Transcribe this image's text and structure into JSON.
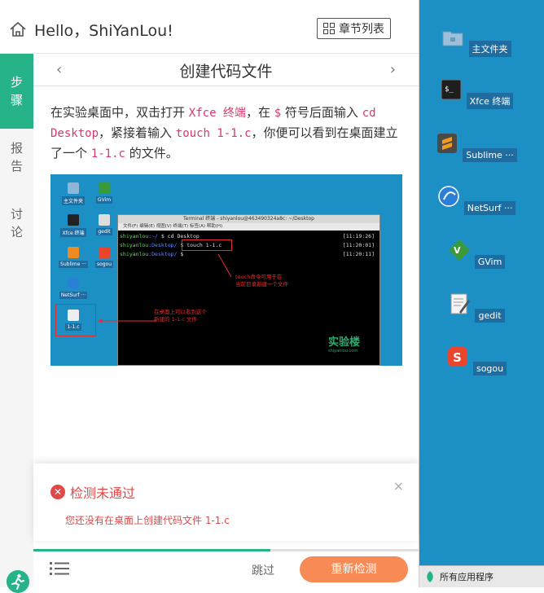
{
  "topbar": {
    "app_title": "Hello，ShiYanLou!",
    "chapter_button": "章节列表"
  },
  "side_tabs": [
    {
      "label_line1": "步",
      "label_line2": "骤"
    },
    {
      "label_line1": "报",
      "label_line2": "告"
    },
    {
      "label_line1": "讨",
      "label_line2": "论"
    }
  ],
  "step": {
    "title": "创建代码文件",
    "prev": "‹",
    "next": "›",
    "instruction": {
      "t1": "在实验桌面中，双击打开 ",
      "c1": "Xfce 终端",
      "t2": "，在 ",
      "c2": "$",
      "t3": " 符号后面输入 ",
      "c3": "cd Desktop",
      "t4": "，紧接着输入 ",
      "c4": "touch 1-1.c",
      "t5": "，你便可以看到在桌面建立了一个 ",
      "c5": "1-1.c",
      "t6": " 的文件。"
    }
  },
  "screenshot": {
    "icons": [
      "主文件夹",
      "GVim",
      "Xfce 终端",
      "gedit",
      "Sublime ···",
      "sogou",
      "NetSurf ···",
      "1-1.c"
    ],
    "terminal_title": "Terminal 终端 - shiyanlou@463490324a8c: ~/Desktop",
    "terminal_menu": "文件(F)   编辑(E)   视图(V)   终端(T)   标签(A)   帮助(H)",
    "lines": [
      {
        "user": "shiyanlou",
        "dir": ":~/ ",
        "cmd": "$ cd Desktop",
        "time": "[11:19:26]"
      },
      {
        "user": "shiyanlou",
        "dir": ":Desktop/ ",
        "cmd": "$ touch 1-1.c",
        "time": "[11:20:01]"
      },
      {
        "user": "shiyanlou",
        "dir": ":Desktop/ ",
        "cmd": "$ ",
        "time": "[11:20:11]"
      }
    ],
    "annotation1_line1": "touch命令可用于在",
    "annotation1_line2": "当前目录新建一个文件",
    "annotation2_line1": "在桌面上可以看到这个",
    "annotation2_line2": "新建的 1-1.c 文件",
    "logo": "实验楼",
    "logo_sub": "shiyanlou.com"
  },
  "result": {
    "title": "检测未通过",
    "close": "×",
    "message": "您还没有在桌面上创建代码文件 1-1.c"
  },
  "progress": {
    "fraction": 0.615
  },
  "bottom": {
    "skip": "跳过",
    "recheck": "重新检测"
  },
  "desktop": {
    "icons": [
      "主文件夹",
      "Xfce 终端",
      "Sublime ···",
      "NetSurf ···",
      "GVim",
      "gedit",
      "sogou"
    ],
    "taskbar_label": "所有应用程序"
  },
  "colors": {
    "accent": "#27b38a",
    "error": "#e04848",
    "button": "#f78a55",
    "desktop": "#1c8fc5"
  }
}
